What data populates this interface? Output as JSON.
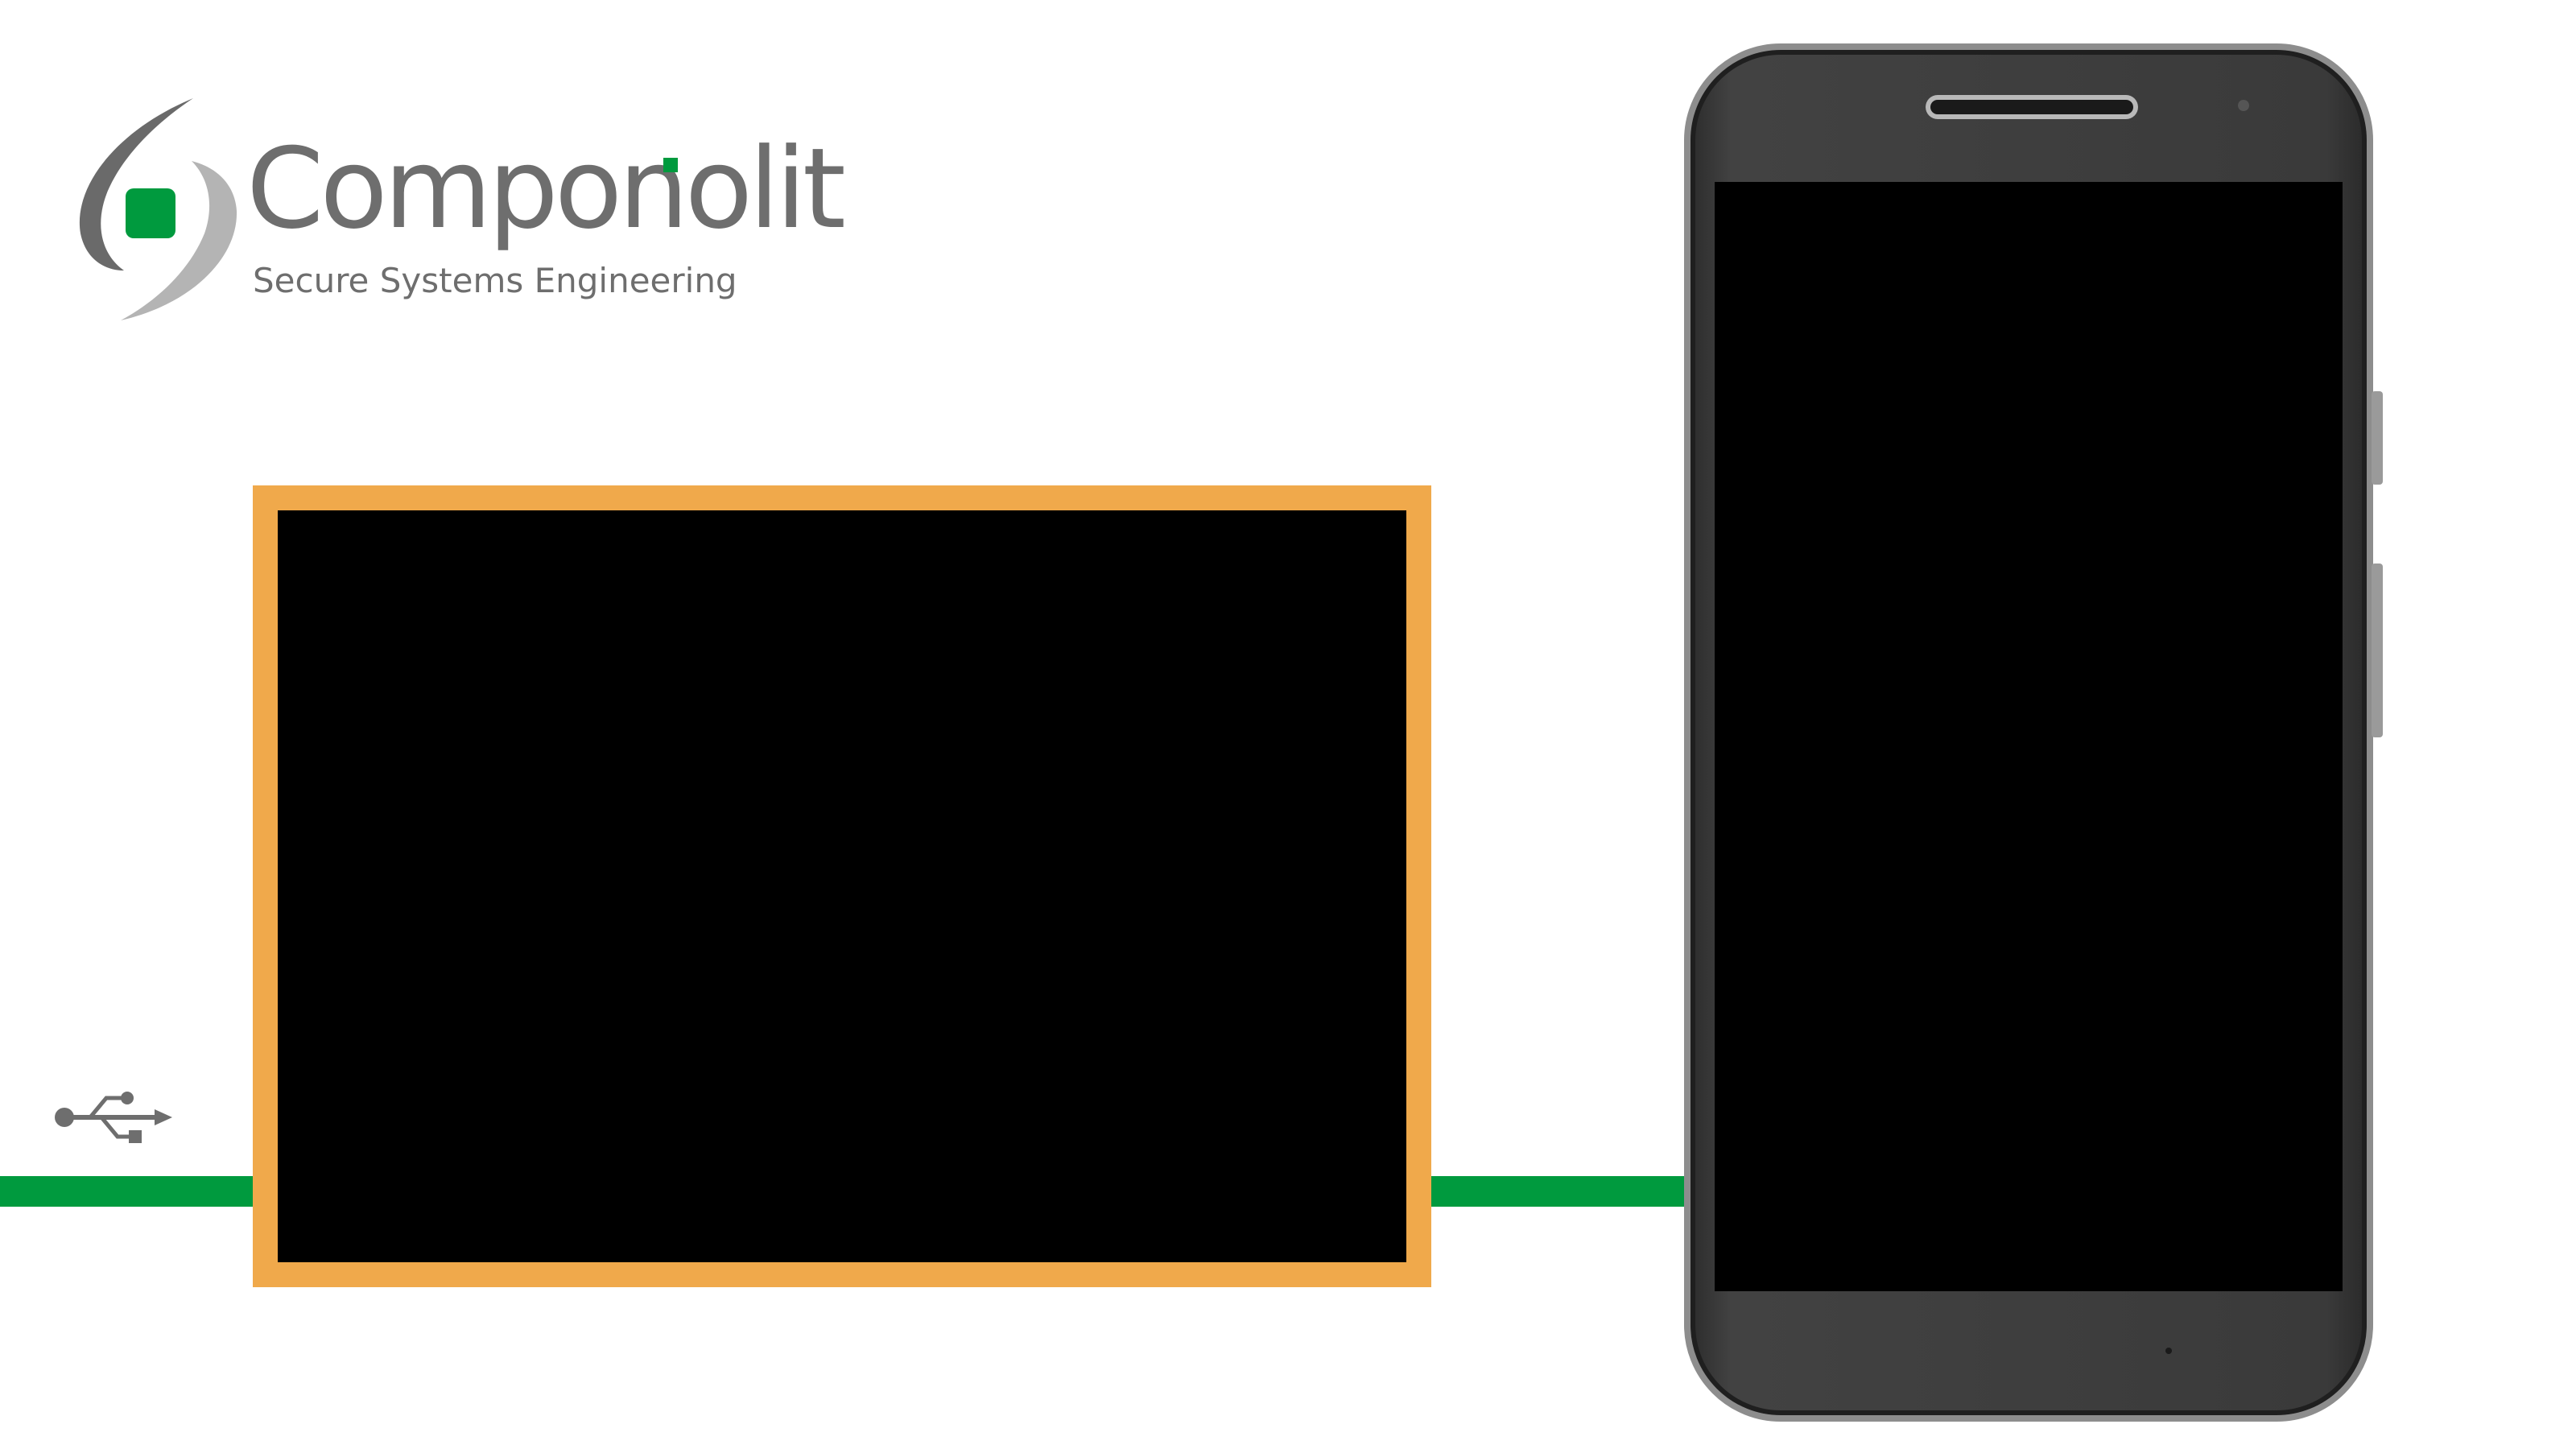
{
  "logo": {
    "brand_name": "Componolit",
    "tagline": "Secure Systems Engineering"
  },
  "icons": {
    "usb": "usb-icon",
    "logo_mark": "componolit-logo-mark"
  },
  "colors": {
    "accent_green": "#009a3e",
    "frame_orange": "#f0a94b",
    "logo_gray": "#6e6e6e",
    "screen_black": "#000000",
    "phone_body": "#3e3e3e"
  }
}
